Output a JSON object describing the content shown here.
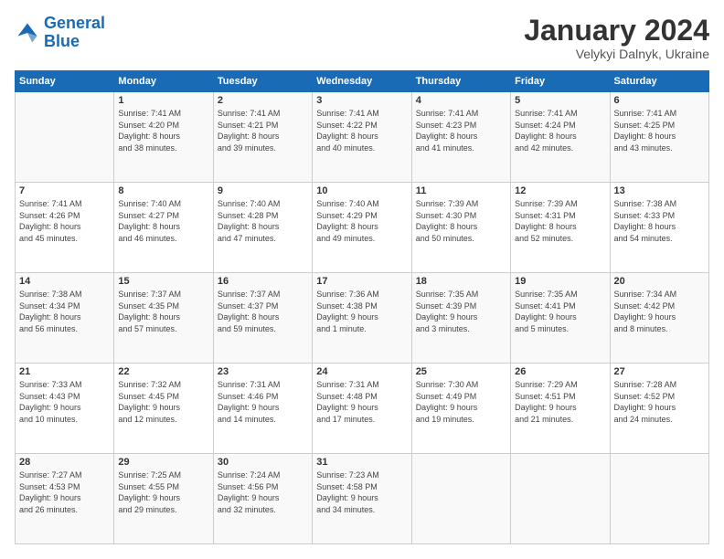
{
  "logo": {
    "text1": "General",
    "text2": "Blue"
  },
  "header": {
    "month": "January 2024",
    "location": "Velykyi Dalnyk, Ukraine"
  },
  "days_of_week": [
    "Sunday",
    "Monday",
    "Tuesday",
    "Wednesday",
    "Thursday",
    "Friday",
    "Saturday"
  ],
  "weeks": [
    [
      {
        "day": "",
        "info": ""
      },
      {
        "day": "1",
        "info": "Sunrise: 7:41 AM\nSunset: 4:20 PM\nDaylight: 8 hours\nand 38 minutes."
      },
      {
        "day": "2",
        "info": "Sunrise: 7:41 AM\nSunset: 4:21 PM\nDaylight: 8 hours\nand 39 minutes."
      },
      {
        "day": "3",
        "info": "Sunrise: 7:41 AM\nSunset: 4:22 PM\nDaylight: 8 hours\nand 40 minutes."
      },
      {
        "day": "4",
        "info": "Sunrise: 7:41 AM\nSunset: 4:23 PM\nDaylight: 8 hours\nand 41 minutes."
      },
      {
        "day": "5",
        "info": "Sunrise: 7:41 AM\nSunset: 4:24 PM\nDaylight: 8 hours\nand 42 minutes."
      },
      {
        "day": "6",
        "info": "Sunrise: 7:41 AM\nSunset: 4:25 PM\nDaylight: 8 hours\nand 43 minutes."
      }
    ],
    [
      {
        "day": "7",
        "info": "Sunrise: 7:41 AM\nSunset: 4:26 PM\nDaylight: 8 hours\nand 45 minutes."
      },
      {
        "day": "8",
        "info": "Sunrise: 7:40 AM\nSunset: 4:27 PM\nDaylight: 8 hours\nand 46 minutes."
      },
      {
        "day": "9",
        "info": "Sunrise: 7:40 AM\nSunset: 4:28 PM\nDaylight: 8 hours\nand 47 minutes."
      },
      {
        "day": "10",
        "info": "Sunrise: 7:40 AM\nSunset: 4:29 PM\nDaylight: 8 hours\nand 49 minutes."
      },
      {
        "day": "11",
        "info": "Sunrise: 7:39 AM\nSunset: 4:30 PM\nDaylight: 8 hours\nand 50 minutes."
      },
      {
        "day": "12",
        "info": "Sunrise: 7:39 AM\nSunset: 4:31 PM\nDaylight: 8 hours\nand 52 minutes."
      },
      {
        "day": "13",
        "info": "Sunrise: 7:38 AM\nSunset: 4:33 PM\nDaylight: 8 hours\nand 54 minutes."
      }
    ],
    [
      {
        "day": "14",
        "info": "Sunrise: 7:38 AM\nSunset: 4:34 PM\nDaylight: 8 hours\nand 56 minutes."
      },
      {
        "day": "15",
        "info": "Sunrise: 7:37 AM\nSunset: 4:35 PM\nDaylight: 8 hours\nand 57 minutes."
      },
      {
        "day": "16",
        "info": "Sunrise: 7:37 AM\nSunset: 4:37 PM\nDaylight: 8 hours\nand 59 minutes."
      },
      {
        "day": "17",
        "info": "Sunrise: 7:36 AM\nSunset: 4:38 PM\nDaylight: 9 hours\nand 1 minute."
      },
      {
        "day": "18",
        "info": "Sunrise: 7:35 AM\nSunset: 4:39 PM\nDaylight: 9 hours\nand 3 minutes."
      },
      {
        "day": "19",
        "info": "Sunrise: 7:35 AM\nSunset: 4:41 PM\nDaylight: 9 hours\nand 5 minutes."
      },
      {
        "day": "20",
        "info": "Sunrise: 7:34 AM\nSunset: 4:42 PM\nDaylight: 9 hours\nand 8 minutes."
      }
    ],
    [
      {
        "day": "21",
        "info": "Sunrise: 7:33 AM\nSunset: 4:43 PM\nDaylight: 9 hours\nand 10 minutes."
      },
      {
        "day": "22",
        "info": "Sunrise: 7:32 AM\nSunset: 4:45 PM\nDaylight: 9 hours\nand 12 minutes."
      },
      {
        "day": "23",
        "info": "Sunrise: 7:31 AM\nSunset: 4:46 PM\nDaylight: 9 hours\nand 14 minutes."
      },
      {
        "day": "24",
        "info": "Sunrise: 7:31 AM\nSunset: 4:48 PM\nDaylight: 9 hours\nand 17 minutes."
      },
      {
        "day": "25",
        "info": "Sunrise: 7:30 AM\nSunset: 4:49 PM\nDaylight: 9 hours\nand 19 minutes."
      },
      {
        "day": "26",
        "info": "Sunrise: 7:29 AM\nSunset: 4:51 PM\nDaylight: 9 hours\nand 21 minutes."
      },
      {
        "day": "27",
        "info": "Sunrise: 7:28 AM\nSunset: 4:52 PM\nDaylight: 9 hours\nand 24 minutes."
      }
    ],
    [
      {
        "day": "28",
        "info": "Sunrise: 7:27 AM\nSunset: 4:53 PM\nDaylight: 9 hours\nand 26 minutes."
      },
      {
        "day": "29",
        "info": "Sunrise: 7:25 AM\nSunset: 4:55 PM\nDaylight: 9 hours\nand 29 minutes."
      },
      {
        "day": "30",
        "info": "Sunrise: 7:24 AM\nSunset: 4:56 PM\nDaylight: 9 hours\nand 32 minutes."
      },
      {
        "day": "31",
        "info": "Sunrise: 7:23 AM\nSunset: 4:58 PM\nDaylight: 9 hours\nand 34 minutes."
      },
      {
        "day": "",
        "info": ""
      },
      {
        "day": "",
        "info": ""
      },
      {
        "day": "",
        "info": ""
      }
    ]
  ]
}
